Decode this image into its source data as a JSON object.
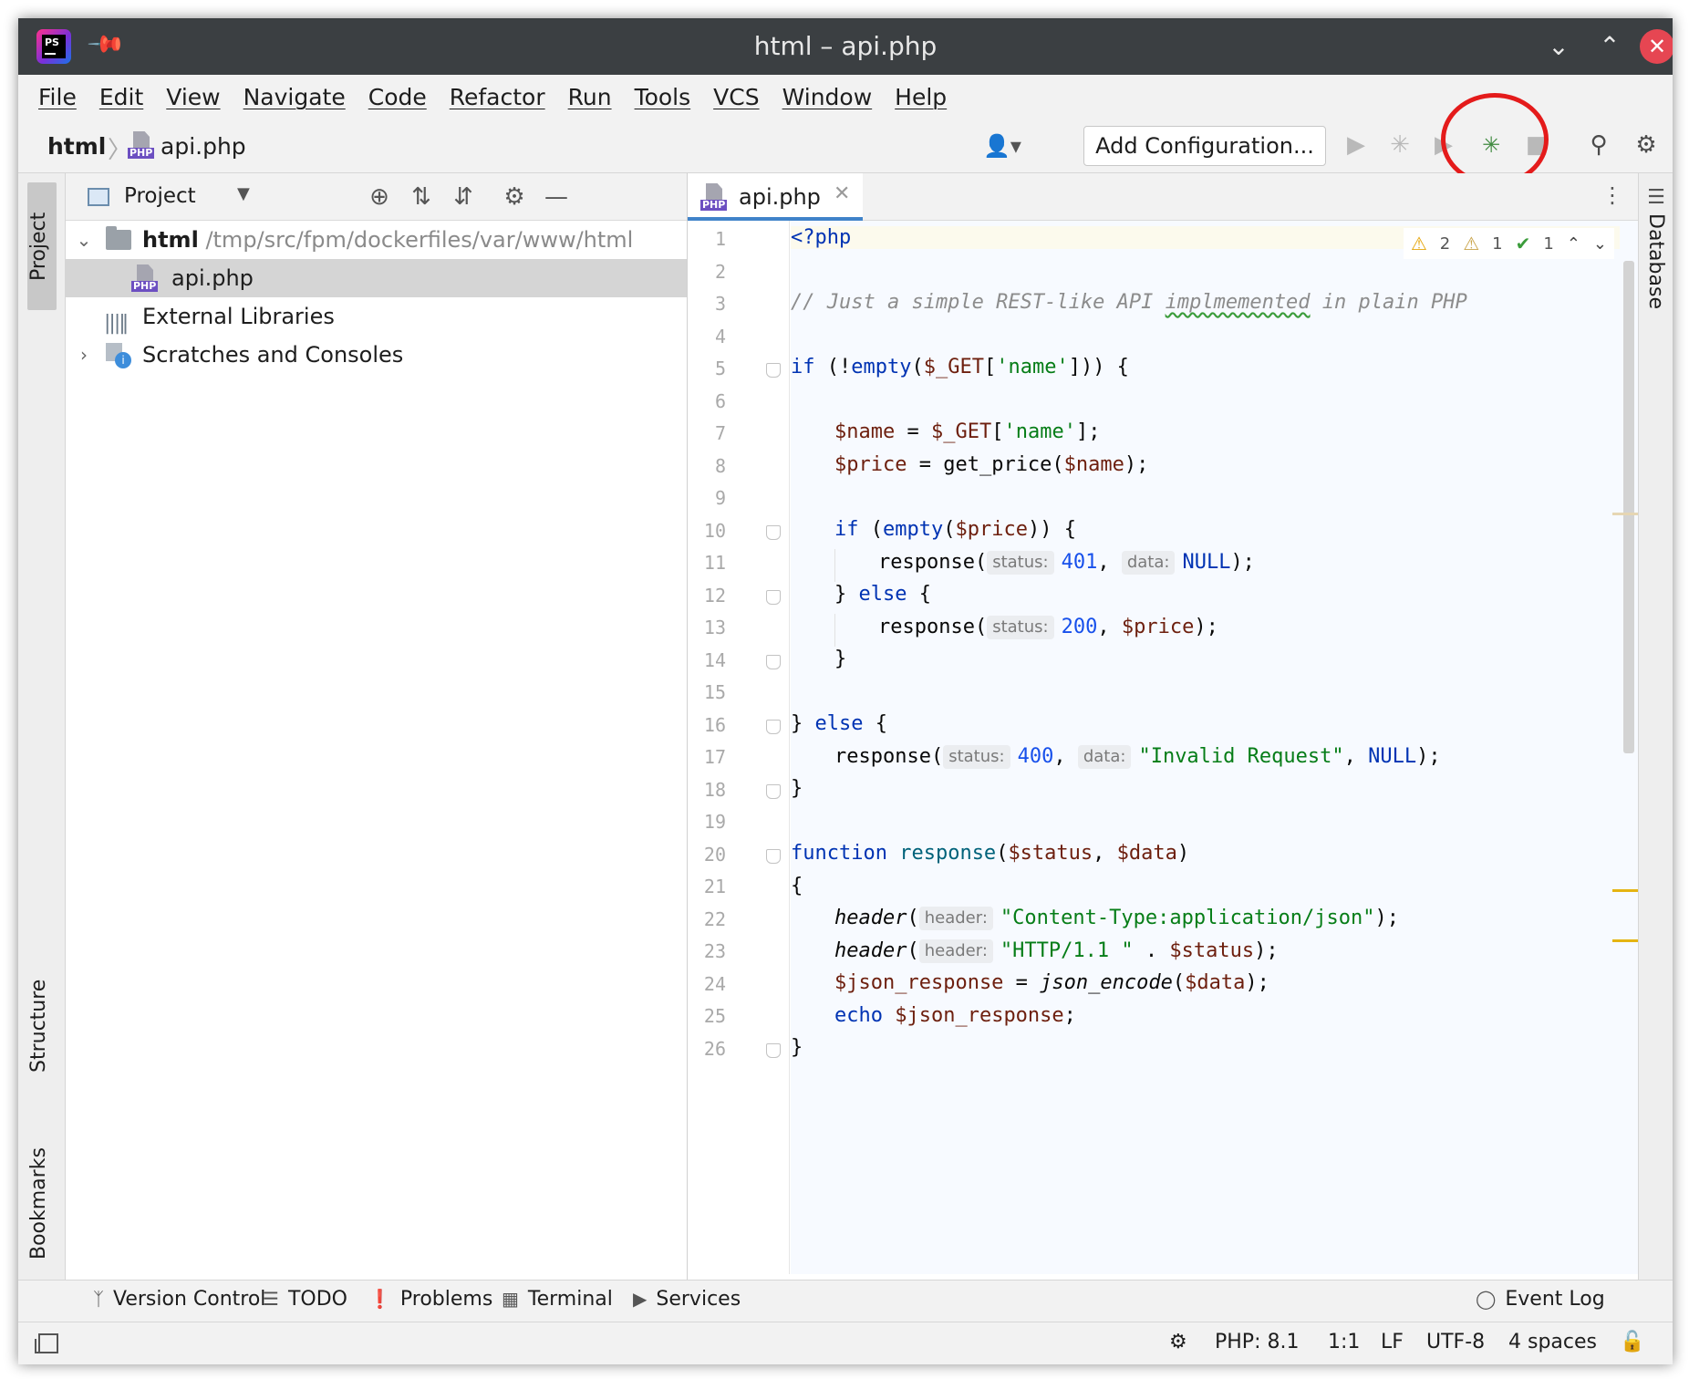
{
  "window": {
    "title": "html – api.php"
  },
  "menu": [
    "File",
    "Edit",
    "View",
    "Navigate",
    "Code",
    "Refactor",
    "Run",
    "Tools",
    "VCS",
    "Window",
    "Help"
  ],
  "breadcrumb": {
    "root": "html",
    "file": "api.php"
  },
  "toolbar": {
    "add_configuration": "Add Configuration..."
  },
  "left_strip": {
    "project": "Project",
    "structure": "Structure",
    "bookmarks": "Bookmarks"
  },
  "right_strip": {
    "database": "Database"
  },
  "project_panel": {
    "title": "Project",
    "tree": [
      {
        "label": "html",
        "path": "/tmp/src/fpm/dockerfiles/var/www/html"
      },
      {
        "label": "api.php"
      },
      {
        "label": "External Libraries"
      },
      {
        "label": "Scratches and Consoles"
      }
    ]
  },
  "editor": {
    "tab": "api.php",
    "inspections": {
      "warnings": "2",
      "weak_warnings": "1",
      "ok": "1"
    },
    "line_numbers": [
      "1",
      "2",
      "3",
      "4",
      "5",
      "6",
      "7",
      "8",
      "9",
      "10",
      "11",
      "12",
      "13",
      "14",
      "15",
      "16",
      "17",
      "18",
      "19",
      "20",
      "21",
      "22",
      "23",
      "24",
      "25",
      "26"
    ],
    "code": {
      "l1": "<?php",
      "l3a": "// Just a simple REST-like API ",
      "l3b": "implmemented",
      "l3c": " in plain PHP",
      "l5a": "if",
      "l5b": " (!",
      "l5c": "empty",
      "l5d": "(",
      "l5e": "$_GET",
      "l5f": "[",
      "l5g": "'name'",
      "l5h": "])) {",
      "l7a": "$name",
      "l7b": " = ",
      "l7c": "$_GET",
      "l7d": "[",
      "l7e": "'name'",
      "l7f": "];",
      "l8a": "$price",
      "l8b": " = get_price(",
      "l8c": "$name",
      "l8d": ");",
      "l10a": "if",
      "l10b": " (",
      "l10c": "empty",
      "l10d": "(",
      "l10e": "$price",
      "l10f": ")) {",
      "l11a": "response(",
      "l11h1": "status:",
      "l11b": "401",
      "l11c": ", ",
      "l11h2": "data:",
      "l11d": "NULL",
      "l11e": ");",
      "l12a": "} ",
      "l12b": "else",
      "l12c": " {",
      "l13a": "response(",
      "l13h1": "status:",
      "l13b": "200",
      "l13c": ", ",
      "l13d": "$price",
      "l13e": ");",
      "l14": "}",
      "l16a": "} ",
      "l16b": "else",
      "l16c": " {",
      "l17a": "response(",
      "l17h1": "status:",
      "l17b": "400",
      "l17c": ", ",
      "l17h2": "data:",
      "l17d": "\"Invalid Request\"",
      "l17e": ", ",
      "l17f": "NULL",
      "l17g": ");",
      "l18": "}",
      "l20a": "function",
      "l20b": " ",
      "l20c": "response",
      "l20d": "(",
      "l20e": "$status",
      "l20f": ", ",
      "l20g": "$data",
      "l20h": ")",
      "l21": "{",
      "l22a": "header",
      "l22b": "(",
      "l22h": "header:",
      "l22c": "\"Content-Type:application/json\"",
      "l22d": ");",
      "l23a": "header",
      "l23b": "(",
      "l23h": "header:",
      "l23c": "\"HTTP/1.1 \"",
      "l23d": " . ",
      "l23e": "$status",
      "l23f": ");",
      "l24a": "$json_response",
      "l24b": " = ",
      "l24c": "json_encode",
      "l24d": "(",
      "l24e": "$data",
      "l24f": ");",
      "l25a": "echo",
      "l25b": " ",
      "l25c": "$json_response",
      "l25d": ";",
      "l26": "}"
    }
  },
  "bottom_tools": [
    "Version Control",
    "TODO",
    "Problems",
    "Terminal",
    "Services",
    "Event Log"
  ],
  "status_bar": {
    "php": "PHP: 8.1",
    "position": "1:1",
    "line_sep": "LF",
    "encoding": "UTF-8",
    "indent": "4 spaces"
  },
  "colors": {
    "titlebar": "#3b3f42",
    "accent": "#4083c9",
    "highlight_circle": "#e41b1b"
  }
}
